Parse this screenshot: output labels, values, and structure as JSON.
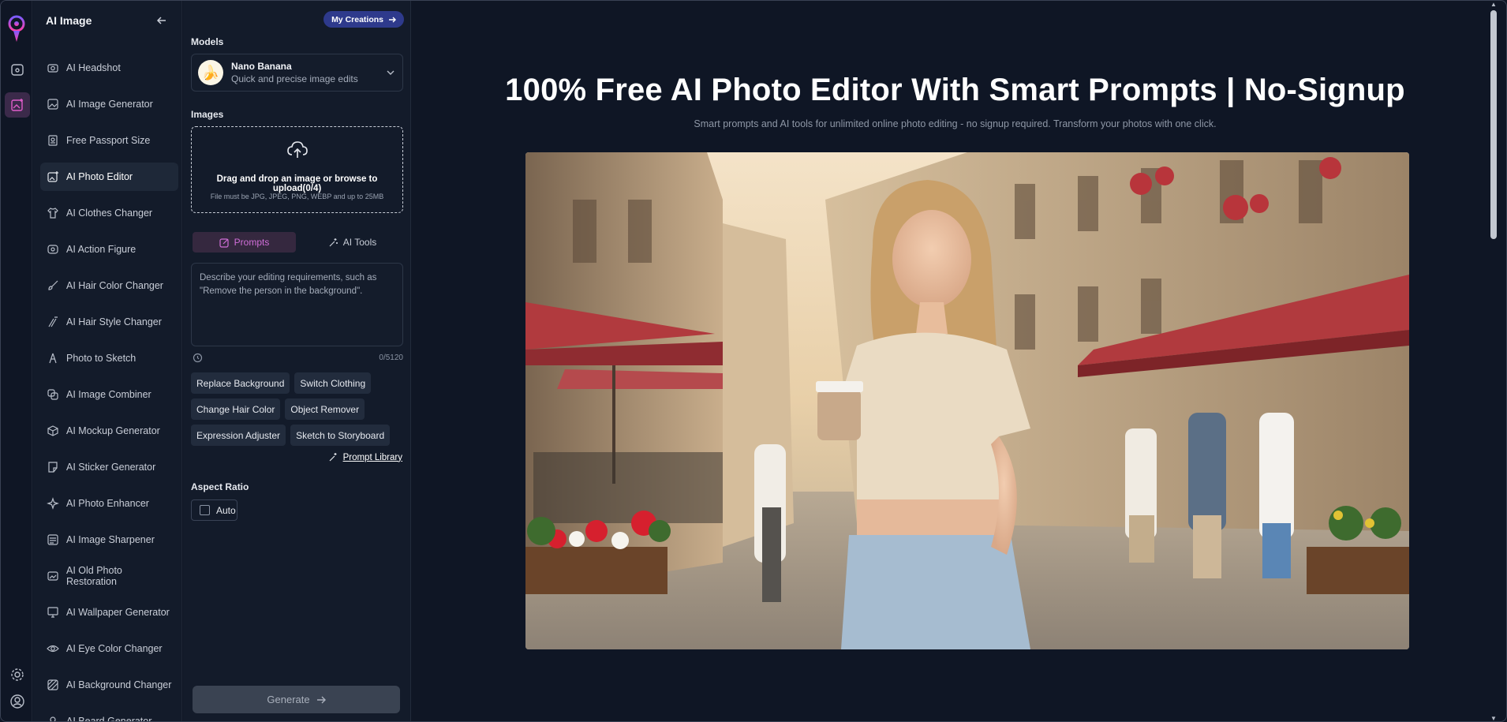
{
  "sidebar": {
    "title": "AI Image",
    "items": [
      {
        "label": "AI Headshot",
        "icon": "camera-icon"
      },
      {
        "label": "AI Image Generator",
        "icon": "image-icon"
      },
      {
        "label": "Free Passport Size",
        "icon": "passport-icon"
      },
      {
        "label": "AI Photo Editor",
        "icon": "photo-edit-icon",
        "active": true
      },
      {
        "label": "AI Clothes Changer",
        "icon": "shirt-icon"
      },
      {
        "label": "AI Action Figure",
        "icon": "figure-icon"
      },
      {
        "label": "AI Hair Color Changer",
        "icon": "brush-icon"
      },
      {
        "label": "AI Hair Style Changer",
        "icon": "hair-icon"
      },
      {
        "label": "Photo to Sketch",
        "icon": "pen-icon"
      },
      {
        "label": "AI Image Combiner",
        "icon": "combine-icon"
      },
      {
        "label": "AI Mockup Generator",
        "icon": "cube-icon"
      },
      {
        "label": "AI Sticker Generator",
        "icon": "sticker-icon"
      },
      {
        "label": "AI Photo Enhancer",
        "icon": "sparkle-icon"
      },
      {
        "label": "AI Image Sharpener",
        "icon": "sharpen-icon"
      },
      {
        "label": "AI Old Photo Restoration",
        "icon": "restore-icon"
      },
      {
        "label": "AI Wallpaper Generator",
        "icon": "monitor-icon"
      },
      {
        "label": "AI Eye Color Changer",
        "icon": "eye-icon"
      },
      {
        "label": "AI Background Changer",
        "icon": "background-icon"
      },
      {
        "label": "AI Beard Generator",
        "icon": "beard-icon"
      }
    ]
  },
  "panel": {
    "my_creations": "My Creations",
    "models_label": "Models",
    "model_name": "Nano Banana",
    "model_desc": "Quick and precise image edits",
    "images_label": "Images",
    "upload_main": "Drag and drop an image or browse to upload(0/4)",
    "upload_sub": "File must be JPG, JPEG, PNG, WEBP and up to 25MB",
    "tab_prompts": "Prompts",
    "tab_tools": "AI Tools",
    "prompt_placeholder": "Describe your editing requirements, such as \"Remove the person in the background\".",
    "counter": "0/5120",
    "chips": [
      "Replace Background",
      "Switch Clothing",
      "Change Hair Color",
      "Object Remover",
      "Expression Adjuster",
      "Sketch to Storyboard"
    ],
    "prompt_library": "Prompt Library",
    "aspect_label": "Aspect Ratio",
    "aspect_value": "Auto",
    "generate": "Generate"
  },
  "main": {
    "title": "100% Free AI Photo Editor With Smart Prompts | No-Signup",
    "subtitle": "Smart prompts and AI tools for unlimited online photo editing - no signup required. Transform your photos with one click."
  },
  "colors": {
    "accent": "#d06ed8",
    "primary_button": "#2e3a8c",
    "background": "#0f1625"
  }
}
